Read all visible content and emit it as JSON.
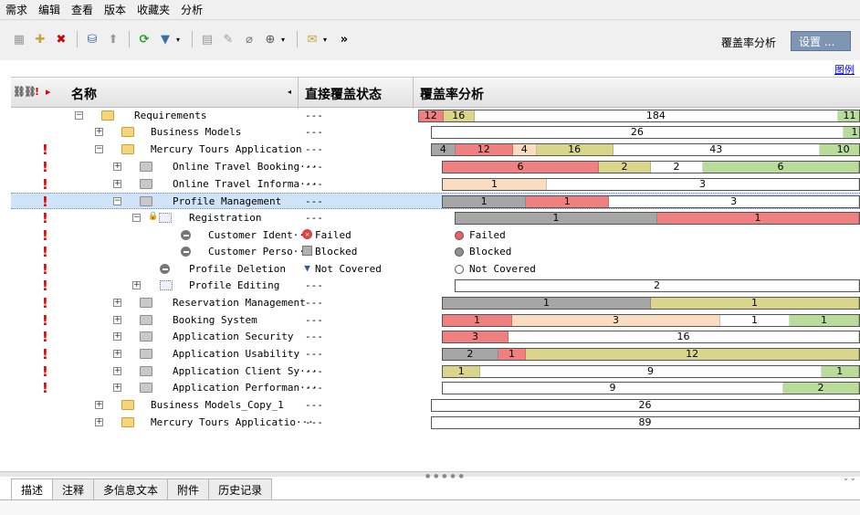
{
  "menu": [
    "需求",
    "编辑",
    "查看",
    "版本",
    "收藏夹",
    "分析"
  ],
  "toolbar": {
    "coverage_label": "覆盖率分析",
    "settings_label": "设置 ...",
    "more": "»"
  },
  "legend_link": "图例",
  "header": {
    "icons": [
      "⛓",
      "⛓",
      "!",
      "▸"
    ],
    "name": "名称",
    "arrow": "◂",
    "status": "直接覆盖状态",
    "coverage": "覆盖率分析"
  },
  "rows": [
    {
      "label": "Requirements",
      "status": "---",
      "req": false,
      "expander": "−",
      "icon": "folder",
      "segments": [
        {
          "value": "12",
          "color": "#f08080"
        },
        {
          "value": "16",
          "color": "#d9d58a"
        },
        {
          "value": "184",
          "color": "#ffffff"
        },
        {
          "value": "11",
          "color": "#b9dc9b"
        }
      ]
    },
    {
      "label": "Business Models",
      "status": "---",
      "req": false,
      "expander": "+",
      "icon": "folder",
      "segments": [
        {
          "value": "26",
          "color": "#ffffff"
        },
        {
          "value": "1",
          "color": "#b9dc9b"
        }
      ]
    },
    {
      "label": "Mercury Tours Application",
      "status": "---",
      "req": true,
      "expander": "−",
      "icon": "folder",
      "segments": [
        {
          "value": "4",
          "color": "#a6a6a6"
        },
        {
          "value": "12",
          "color": "#f08080"
        },
        {
          "value": "4",
          "color": "#fadcc0"
        },
        {
          "value": "16",
          "color": "#d9d58a"
        },
        {
          "value": "43",
          "color": "#ffffff"
        },
        {
          "value": "10",
          "color": "#b9dc9b"
        }
      ]
    },
    {
      "label": "Online Travel Booking···",
      "status": "---",
      "req": true,
      "expander": "+",
      "icon": "module",
      "segments": [
        {
          "value": "6",
          "color": "#f08080"
        },
        {
          "value": "2",
          "color": "#d9d58a"
        },
        {
          "value": "2",
          "color": "#ffffff"
        },
        {
          "value": "6",
          "color": "#b9dc9b"
        }
      ]
    },
    {
      "label": "Online Travel Informa···",
      "status": "---",
      "req": true,
      "expander": "+",
      "icon": "module",
      "segments": [
        {
          "value": "1",
          "color": "#fadcc0"
        },
        {
          "value": "3",
          "color": "#ffffff"
        }
      ]
    },
    {
      "label": "Profile Management",
      "status": "---",
      "req": true,
      "expander": "−",
      "icon": "module",
      "selected": true,
      "segments": [
        {
          "value": "1",
          "color": "#a6a6a6"
        },
        {
          "value": "1",
          "color": "#f08080"
        },
        {
          "value": "3",
          "color": "#ffffff"
        }
      ]
    },
    {
      "label": "Registration",
      "status": "---",
      "req": true,
      "expander": "−",
      "icon": "dotted",
      "segments": [
        {
          "value": "1",
          "color": "#a6a6a6"
        },
        {
          "value": "1",
          "color": "#f08080"
        }
      ]
    },
    {
      "label": "Customer Ident···",
      "status": "Failed",
      "status_type": "failed",
      "req": true,
      "icon": "dot",
      "legend": {
        "label": "Failed",
        "color": "#f06060"
      }
    },
    {
      "label": "Customer Perso···",
      "status": "Blocked",
      "status_type": "blocked",
      "req": true,
      "icon": "dot",
      "legend": {
        "label": "Blocked",
        "color": "#909090"
      }
    },
    {
      "label": "Profile Deletion",
      "status": "Not Covered",
      "status_type": "notcovered",
      "req": true,
      "icon": "dot",
      "legend": {
        "label": "Not Covered",
        "color": "#ffffff"
      }
    },
    {
      "label": "Profile Editing",
      "status": "---",
      "req": true,
      "expander": "+",
      "icon": "dotted",
      "segments": [
        {
          "value": "2",
          "color": "#ffffff"
        }
      ]
    },
    {
      "label": "Reservation Management",
      "status": "---",
      "req": true,
      "expander": "+",
      "icon": "module",
      "segments": [
        {
          "value": "1",
          "color": "#a6a6a6"
        },
        {
          "value": "1",
          "color": "#d9d58a"
        }
      ]
    },
    {
      "label": "Booking System",
      "status": "---",
      "req": true,
      "expander": "+",
      "icon": "module",
      "segments": [
        {
          "value": "1",
          "color": "#f08080"
        },
        {
          "value": "3",
          "color": "#fadcc0"
        },
        {
          "value": "1",
          "color": "#ffffff"
        },
        {
          "value": "1",
          "color": "#b9dc9b"
        }
      ]
    },
    {
      "label": "Application Security",
      "status": "---",
      "req": true,
      "expander": "+",
      "icon": "module",
      "segments": [
        {
          "value": "3",
          "color": "#f08080"
        },
        {
          "value": "16",
          "color": "#ffffff"
        }
      ]
    },
    {
      "label": "Application Usability",
      "status": "---",
      "req": true,
      "expander": "+",
      "icon": "module",
      "segments": [
        {
          "value": "2",
          "color": "#a6a6a6"
        },
        {
          "value": "1",
          "color": "#f08080"
        },
        {
          "value": "12",
          "color": "#d9d58a"
        }
      ]
    },
    {
      "label": "Application Client Sy···",
      "status": "---",
      "req": true,
      "expander": "+",
      "icon": "module",
      "segments": [
        {
          "value": "1",
          "color": "#d9d58a"
        },
        {
          "value": "9",
          "color": "#ffffff"
        },
        {
          "value": "1",
          "color": "#b9dc9b"
        }
      ]
    },
    {
      "label": "Application Performan···",
      "status": "---",
      "req": true,
      "expander": "+",
      "icon": "module",
      "segments": [
        {
          "value": "9",
          "color": "#ffffff"
        },
        {
          "value": "2",
          "color": "#b9dc9b"
        }
      ]
    },
    {
      "label": "Business Models_Copy_1",
      "status": "---",
      "req": false,
      "expander": "+",
      "icon": "folder",
      "segments": [
        {
          "value": "26",
          "color": "#ffffff"
        }
      ]
    },
    {
      "label": "Mercury Tours Applicatio···",
      "status": "---",
      "req": false,
      "expander": "+",
      "icon": "folder",
      "segments": [
        {
          "value": "89",
          "color": "#ffffff"
        }
      ]
    }
  ],
  "tabs": [
    "描述",
    "注释",
    "多信息文本",
    "附件",
    "历史记录"
  ],
  "active_tab": 0
}
